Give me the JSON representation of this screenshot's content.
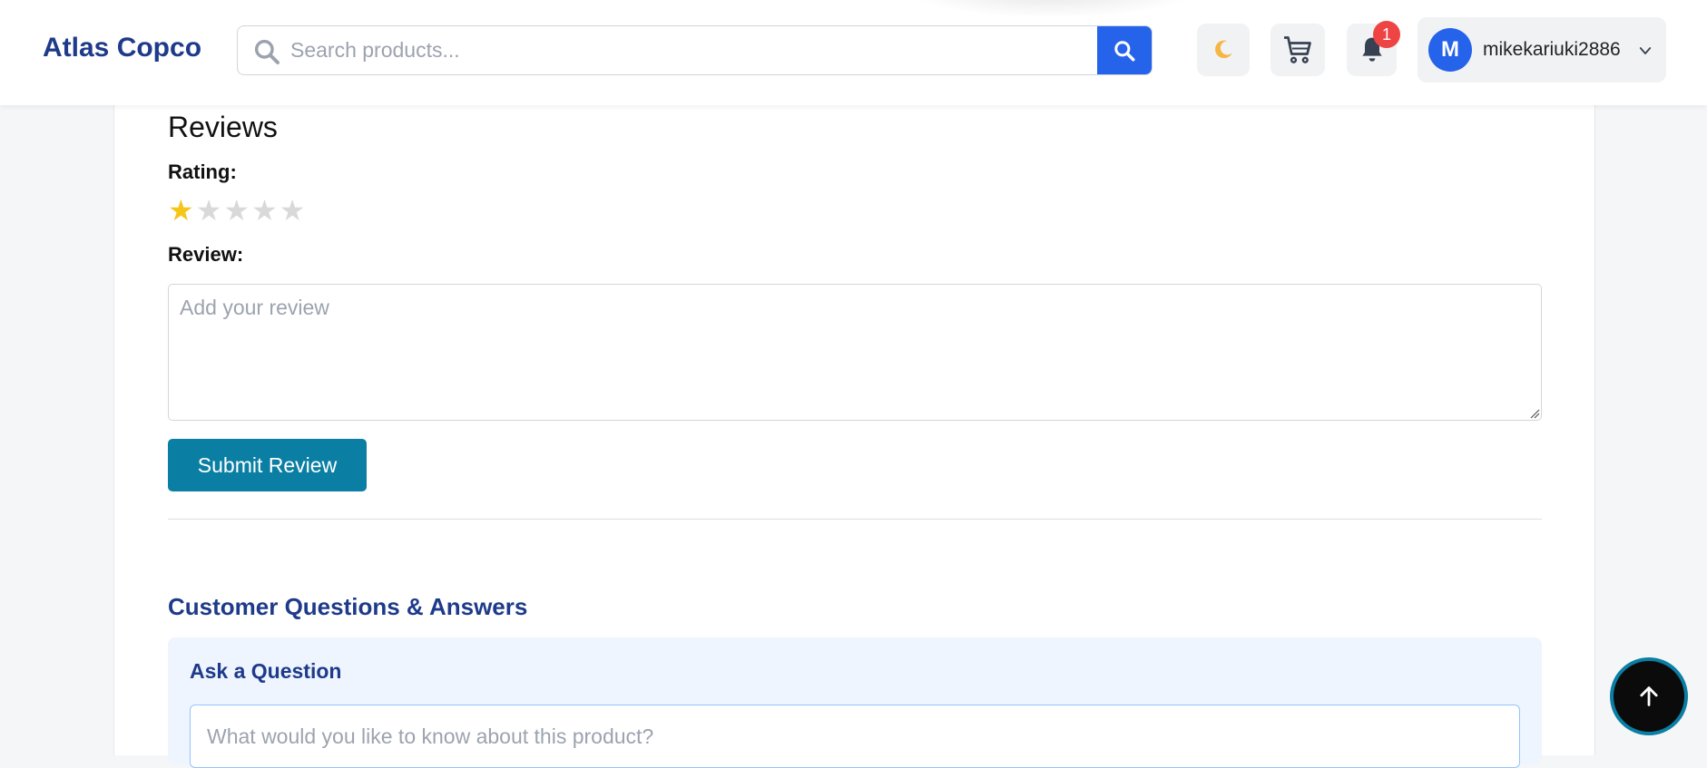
{
  "header": {
    "brand": "Atlas Copco",
    "search_placeholder": "Search products...",
    "theme_icon": "moon-icon",
    "notification_count": "1",
    "user_initial": "M",
    "username": "mikekariuki2886"
  },
  "reviews": {
    "title": "Reviews",
    "rating_label": "Rating:",
    "rating_value": 1,
    "rating_max": 5,
    "star_glyph": "★",
    "star_filled_color": "#f5c518",
    "star_empty_color": "#d9d9d9",
    "review_label": "Review:",
    "review_placeholder": "Add your review",
    "submit_label": "Submit Review"
  },
  "qa": {
    "title": "Customer Questions & Answers",
    "ask_title": "Ask a Question",
    "question_placeholder": "What would you like to know about this product?"
  },
  "colors": {
    "brand": "#1e3a8a",
    "primary": "#2563eb",
    "submit": "#0b7ea3",
    "badge": "#ef4444"
  }
}
